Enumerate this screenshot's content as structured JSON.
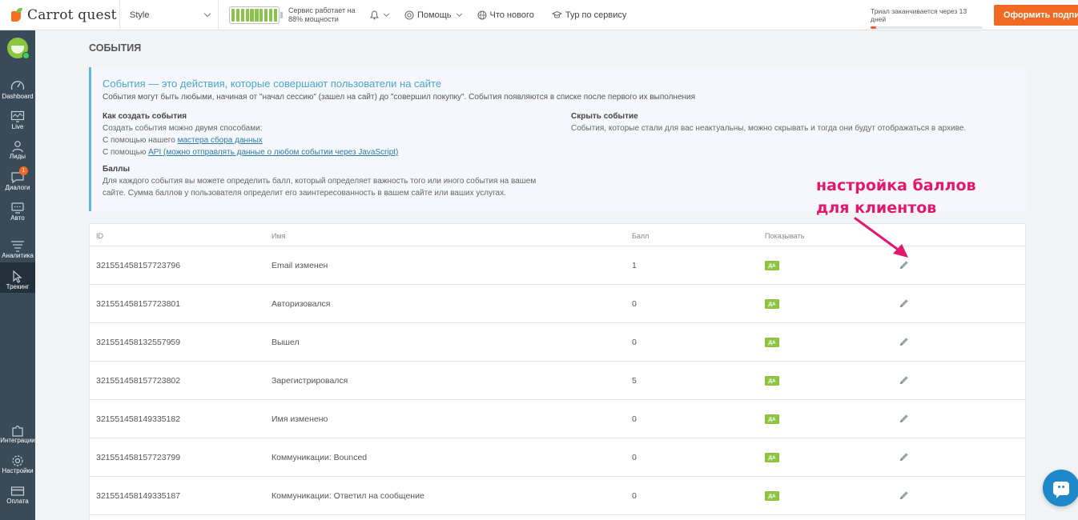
{
  "topbar": {
    "logo_text": "Carrot quest",
    "site_select": "Style",
    "status_text": "Сервис работает на 88% мощности",
    "battery_cells": 10,
    "nav": [
      {
        "label": "Помощь",
        "icon": "help-icon"
      },
      {
        "label": "Что нового",
        "icon": "globe-icon"
      },
      {
        "label": "Тур по сервису",
        "icon": "graduation-cap-icon"
      }
    ],
    "trial_text": "Триал заканчивается через 13 дней",
    "trial_progress": 0.05,
    "subscribe_label": "Оформить подписку"
  },
  "sidebar": {
    "items": [
      {
        "label": "Dashboard",
        "icon": "speedometer-icon"
      },
      {
        "label": "Live",
        "icon": "monitor-icon"
      },
      {
        "label": "Лиды",
        "icon": "user-icon"
      },
      {
        "label": "Диалоги",
        "icon": "chat-icon",
        "badge": "1"
      },
      {
        "label": "Авто",
        "icon": "auto-message-icon"
      },
      {
        "label": "Аналитика",
        "icon": "funnel-icon"
      },
      {
        "label": "Трекинг",
        "icon": "cursor-icon",
        "active": true
      },
      {
        "label": "Интеграции",
        "icon": "puzzle-icon"
      },
      {
        "label": "Настройки",
        "icon": "gear-icon"
      },
      {
        "label": "Оплата",
        "icon": "credit-card-icon"
      }
    ]
  },
  "page": {
    "title": "СОБЫТИЯ"
  },
  "info": {
    "heading": "События — это действия, которые совершают пользователи на сайте",
    "intro": "События могут быть любыми, начиная от \"начал сессию\" (зашел на сайт) до \"совершил покупку\". События появляются в списке после первого их выполнения",
    "create_title": "Как создать события",
    "create_line1": "Создать события можно двумя способами:",
    "create_line2_prefix": "С помощью нашего ",
    "create_line2_link": "мастера сбора данных",
    "create_line3_prefix": "С помощью ",
    "create_line3_link": "API (можно отправлять данные о любом событии через JavaScript)",
    "hide_title": "Скрыть событие",
    "hide_text": "События, которые стали для вас неактуальны, можно скрывать и тогда они будут отображаться в архиве.",
    "score_title": "Баллы",
    "score_line1": "Для каждого события вы можете определить балл, который определяет важность того или иного события на вашем",
    "score_line2": "сайте. Сумма баллов у пользователя определит его заинтересованность в вашем сайте или ваших услугах."
  },
  "table": {
    "headers": {
      "id": "ID",
      "name": "Имя",
      "score": "Балл",
      "show": "Показывать"
    },
    "rows": [
      {
        "id": "3215514581577237​96",
        "name": "Email изменен",
        "score": "1",
        "show": "ДА"
      },
      {
        "id": "321551458157723801",
        "name": "Авторизовался",
        "score": "0",
        "show": "ДА"
      },
      {
        "id": "321551458132557959",
        "name": "Вышел",
        "score": "0",
        "show": "ДА"
      },
      {
        "id": "321551458157723802",
        "name": "Зарегистрировался",
        "score": "5",
        "show": "ДА"
      },
      {
        "id": "321551458149335182",
        "name": "Имя изменено",
        "score": "0",
        "show": "ДА"
      },
      {
        "id": "321551458157723799",
        "name": "Коммуникации: Bounced",
        "score": "0",
        "show": "ДА"
      },
      {
        "id": "321551458149335187",
        "name": "Коммуникации: Ответил на сообщение",
        "score": "0",
        "show": "ДА"
      }
    ]
  },
  "annotation": {
    "line1": "настройка баллов",
    "line2": "для клиентов",
    "color": "#e3186d"
  },
  "colors": {
    "accent": "#f06a24",
    "sidebar": "#394a58",
    "info_heading": "#4aa5d0",
    "yes_badge": "#8cc63f"
  }
}
